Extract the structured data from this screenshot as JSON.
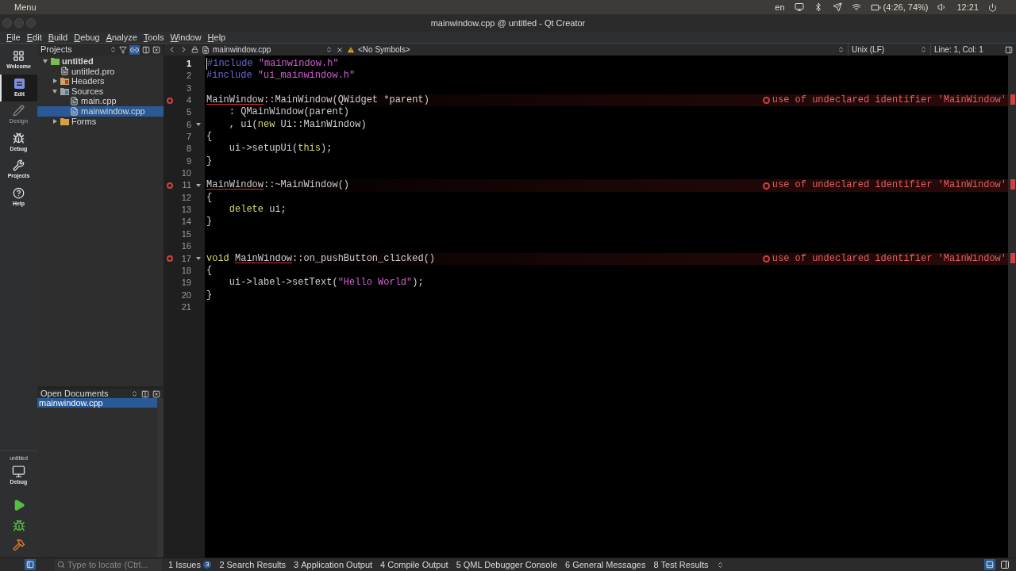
{
  "top_bar": {
    "menu": "Menu",
    "language": "en",
    "battery": "(4:26, 74%)",
    "clock": "12:21"
  },
  "window": {
    "title": "mainwindow.cpp @ untitled - Qt Creator"
  },
  "menu": [
    "File",
    "Edit",
    "Build",
    "Debug",
    "Analyze",
    "Tools",
    "Window",
    "Help"
  ],
  "modes": [
    {
      "label": "Welcome",
      "kind": "welcome",
      "selected": false,
      "disabled": false
    },
    {
      "label": "Edit",
      "kind": "edit",
      "selected": true,
      "disabled": false
    },
    {
      "label": "Design",
      "kind": "design",
      "selected": false,
      "disabled": true
    },
    {
      "label": "Debug",
      "kind": "debug",
      "selected": false,
      "disabled": false
    },
    {
      "label": "Projects",
      "kind": "projects",
      "selected": false,
      "disabled": false
    },
    {
      "label": "Help",
      "kind": "help",
      "selected": false,
      "disabled": false
    }
  ],
  "target": {
    "project": "untitled",
    "config": "Debug"
  },
  "projects_panel": {
    "title": "Projects",
    "tree": [
      {
        "label": "untitled",
        "kind": "project",
        "expanded": true,
        "selected": false,
        "children": [
          {
            "label": "untitled.pro",
            "kind": "file",
            "selected": false
          },
          {
            "label": "Headers",
            "kind": "headers",
            "expanded": false,
            "selected": false
          },
          {
            "label": "Sources",
            "kind": "sources",
            "expanded": true,
            "selected": false,
            "children": [
              {
                "label": "main.cpp",
                "kind": "file",
                "selected": false
              },
              {
                "label": "mainwindow.cpp",
                "kind": "file",
                "selected": true
              }
            ]
          },
          {
            "label": "Forms",
            "kind": "forms",
            "expanded": false,
            "selected": false
          }
        ]
      }
    ]
  },
  "open_documents": {
    "title": "Open Documents",
    "items": [
      {
        "label": "mainwindow.cpp",
        "selected": true
      }
    ]
  },
  "editor": {
    "file": "mainwindow.cpp",
    "symbols": "<No Symbols>",
    "line_ending": "Unix (LF)",
    "position": "Line: 1, Col: 1",
    "lines": [
      {
        "number": "1",
        "current": true,
        "foldable": false,
        "tokens": [
          {
            "kind": "pre",
            "text": "#include "
          },
          {
            "kind": "str",
            "text": "\"mainwindow.h\""
          }
        ]
      },
      {
        "number": "2",
        "current": false,
        "foldable": false,
        "tokens": [
          {
            "kind": "pre",
            "text": "#include "
          },
          {
            "kind": "str",
            "text": "\"ui_mainwindow.h\""
          }
        ]
      },
      {
        "number": "3",
        "current": false,
        "foldable": false
      },
      {
        "number": "4",
        "current": false,
        "foldable": false,
        "error": "use of undeclared identifier 'MainWindow'",
        "tokens": [
          {
            "kind": "err",
            "text": "MainWindow"
          },
          {
            "kind": "plain",
            "text": "::MainWindow(QWidget *parent)"
          }
        ]
      },
      {
        "number": "5",
        "current": false,
        "foldable": false,
        "tokens": [
          {
            "kind": "plain",
            "text": "    : QMainWindow(parent)"
          }
        ]
      },
      {
        "number": "6",
        "current": false,
        "foldable": true,
        "tokens": [
          {
            "kind": "plain",
            "text": "    , ui("
          },
          {
            "kind": "kw",
            "text": "new"
          },
          {
            "kind": "plain",
            "text": " Ui::MainWindow)"
          }
        ]
      },
      {
        "number": "7",
        "current": false,
        "foldable": false,
        "tokens": [
          {
            "kind": "plain",
            "text": "{"
          }
        ]
      },
      {
        "number": "8",
        "current": false,
        "foldable": false,
        "tokens": [
          {
            "kind": "plain",
            "text": "    ui->setupUi("
          },
          {
            "kind": "kw",
            "text": "this"
          },
          {
            "kind": "plain",
            "text": ");"
          }
        ]
      },
      {
        "number": "9",
        "current": false,
        "foldable": false,
        "tokens": [
          {
            "kind": "plain",
            "text": "}"
          }
        ]
      },
      {
        "number": "10",
        "current": false,
        "foldable": false
      },
      {
        "number": "11",
        "current": false,
        "foldable": true,
        "error": "use of undeclared identifier 'MainWindow'",
        "tokens": [
          {
            "kind": "err",
            "text": "MainWindow"
          },
          {
            "kind": "plain",
            "text": "::~MainWindow()"
          }
        ]
      },
      {
        "number": "12",
        "current": false,
        "foldable": false,
        "tokens": [
          {
            "kind": "plain",
            "text": "{"
          }
        ]
      },
      {
        "number": "13",
        "current": false,
        "foldable": false,
        "tokens": [
          {
            "kind": "kw",
            "text": "    delete"
          },
          {
            "kind": "plain",
            "text": " ui;"
          }
        ]
      },
      {
        "number": "14",
        "current": false,
        "foldable": false,
        "tokens": [
          {
            "kind": "plain",
            "text": "}"
          }
        ]
      },
      {
        "number": "15",
        "current": false,
        "foldable": false
      },
      {
        "number": "16",
        "current": false,
        "foldable": false
      },
      {
        "number": "17",
        "current": false,
        "foldable": true,
        "error": "use of undeclared identifier 'MainWindow'",
        "tokens": [
          {
            "kind": "kw",
            "text": "void "
          },
          {
            "kind": "err",
            "text": "MainWindow"
          },
          {
            "kind": "plain",
            "text": "::on_pushButton_clicked()"
          }
        ]
      },
      {
        "number": "18",
        "current": false,
        "foldable": false,
        "tokens": [
          {
            "kind": "plain",
            "text": "{"
          }
        ]
      },
      {
        "number": "19",
        "current": false,
        "foldable": false,
        "tokens": [
          {
            "kind": "plain",
            "text": "    ui->label->setText("
          },
          {
            "kind": "str",
            "text": "\"Hello World\""
          },
          {
            "kind": "plain",
            "text": ");"
          }
        ]
      },
      {
        "number": "20",
        "current": false,
        "foldable": false,
        "tokens": [
          {
            "kind": "plain",
            "text": "}"
          }
        ]
      },
      {
        "number": "21",
        "current": false,
        "foldable": false
      }
    ]
  },
  "locator": {
    "placeholder": "Type to locate (Ctrl..."
  },
  "output_tabs": [
    {
      "number": "1",
      "label": "Issues",
      "badge": "3"
    },
    {
      "number": "2",
      "label": "Search Results"
    },
    {
      "number": "3",
      "label": "Application Output"
    },
    {
      "number": "4",
      "label": "Compile Output"
    },
    {
      "number": "5",
      "label": "QML Debugger Console"
    },
    {
      "number": "6",
      "label": "General Messages"
    },
    {
      "number": "8",
      "label": "Test Results"
    }
  ]
}
